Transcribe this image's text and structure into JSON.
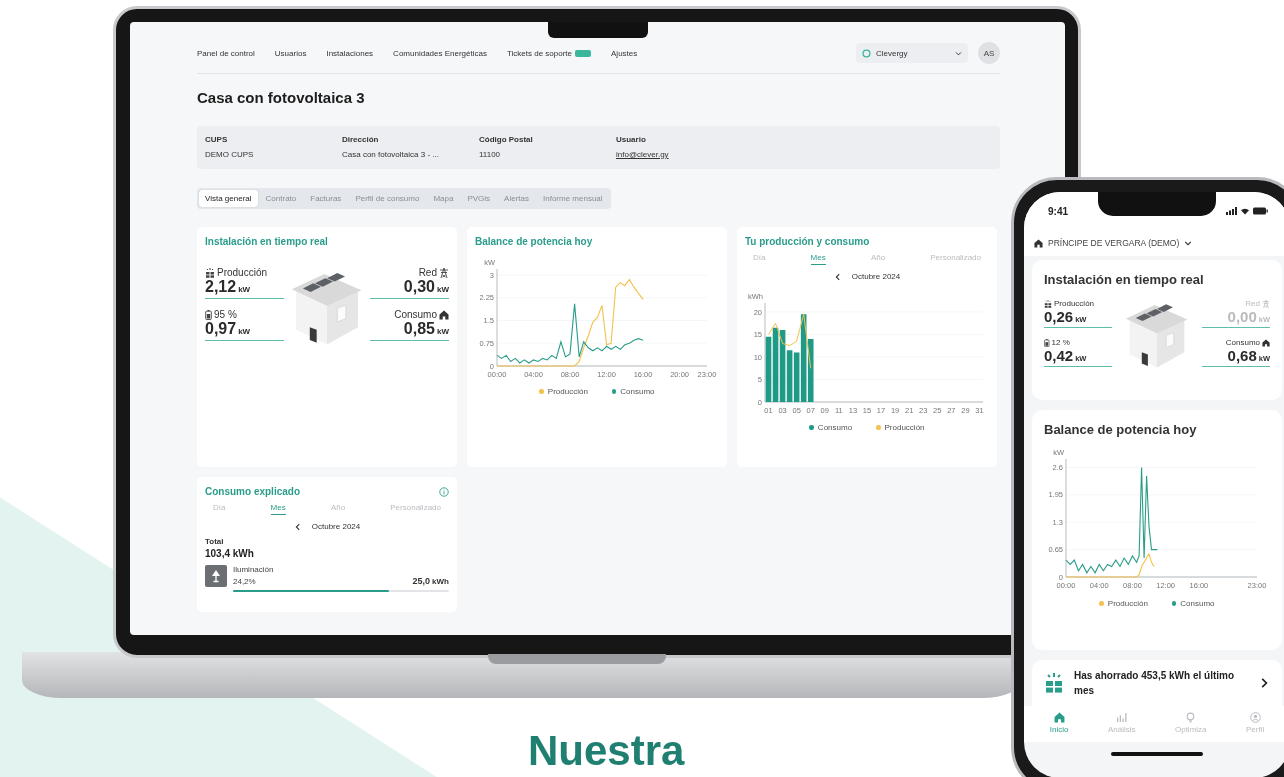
{
  "laptop": {
    "nav": {
      "items": [
        {
          "label": "Panel de control",
          "badge": false
        },
        {
          "label": "Usuarios",
          "badge": false
        },
        {
          "label": "Instalaciones",
          "badge": false
        },
        {
          "label": "Comunidades Energéticas",
          "badge": false
        },
        {
          "label": "Tickets de soporte",
          "badge": true
        },
        {
          "label": "Ajustes",
          "badge": false
        }
      ],
      "org": "Clevergy",
      "avatar": "AS"
    },
    "title": "Casa con fotovoltaica 3",
    "info": [
      {
        "label": "CUPS",
        "value": "DEMO CUPS",
        "kind": "text"
      },
      {
        "label": "Dirección",
        "value": "Casa con fotovoltaica 3 - ...",
        "kind": "text"
      },
      {
        "label": "Código Postal",
        "value": "11100",
        "kind": "text"
      },
      {
        "label": "Usuario",
        "value": "info@clever.gy",
        "kind": "link"
      }
    ],
    "tabs": [
      {
        "label": "Vista general",
        "selected": true
      },
      {
        "label": "Contrato",
        "selected": false
      },
      {
        "label": "Facturas",
        "selected": false
      },
      {
        "label": "Perfil de consumo",
        "selected": false
      },
      {
        "label": "Mapa",
        "selected": false
      },
      {
        "label": "PVGis",
        "selected": false
      },
      {
        "label": "Alertas",
        "selected": false
      },
      {
        "label": "Informe mensual",
        "selected": false
      }
    ],
    "realtime": {
      "title": "Instalación en tiempo real",
      "production": {
        "label": "Producción",
        "value": "2,12",
        "unit": "kW",
        "inactive": false
      },
      "grid": {
        "label": "Red",
        "value": "0,30",
        "unit": "kW",
        "inactive": false
      },
      "battery": {
        "label": "95 %",
        "value": "0,97",
        "unit": "kW",
        "inactive": false
      },
      "consumption": {
        "label": "Consumo",
        "value": "0,85",
        "unit": "kW",
        "inactive": false
      }
    },
    "balance": {
      "title": "Balance de potencia hoy",
      "chart_data": {
        "type": "line",
        "ylabel": "kW",
        "grid": true,
        "x": [
          0,
          0.5,
          1,
          1.5,
          2,
          2.5,
          3,
          3.5,
          4,
          4.5,
          5,
          5.5,
          6,
          6.5,
          7,
          7.5,
          8,
          8.5,
          9,
          9.5,
          10,
          10.5,
          11,
          11.5,
          12,
          12.5,
          13,
          13.5,
          14,
          14.5,
          15,
          15.5,
          16
        ],
        "xlim": [
          0,
          23
        ],
        "ylim": [
          0,
          3.2
        ],
        "xticks": [
          {
            "value": 0,
            "label": "00:00"
          },
          {
            "value": 4,
            "label": "04:00"
          },
          {
            "value": 8,
            "label": "08:00"
          },
          {
            "value": 12,
            "label": "12:00"
          },
          {
            "value": 16,
            "label": "16:00"
          },
          {
            "value": 20,
            "label": "20:00"
          },
          {
            "value": 23,
            "label": "23:00"
          }
        ],
        "yticks": [
          0,
          0.75,
          1.5,
          2.25,
          3
        ],
        "series": [
          {
            "name": "Producción",
            "color": "#f2c14e",
            "values": [
              0,
              0,
              0,
              0,
              0,
              0,
              0,
              0,
              0,
              0,
              0,
              0,
              0,
              0,
              0,
              0,
              0,
              0,
              0.15,
              0.6,
              1.0,
              1.45,
              1.6,
              2.0,
              0.7,
              0.75,
              2.6,
              2.75,
              2.65,
              2.85,
              2.6,
              2.4,
              2.2
            ]
          },
          {
            "name": "Consumo",
            "color": "#2a9d8a",
            "values": [
              0.35,
              0.25,
              0.35,
              0.15,
              0.25,
              0.1,
              0.2,
              0.1,
              0.2,
              0.15,
              0.25,
              0.2,
              0.35,
              0.25,
              0.8,
              0.3,
              0.4,
              2.05,
              0.3,
              0.8,
              0.6,
              0.5,
              0.6,
              0.5,
              0.65,
              0.55,
              0.65,
              0.55,
              0.7,
              0.75,
              0.85,
              0.9,
              0.85
            ]
          }
        ]
      }
    },
    "production_consumption": {
      "title": "Tu producción y consumo",
      "periods": [
        {
          "label": "Día",
          "selected": false
        },
        {
          "label": "Mes",
          "selected": true
        },
        {
          "label": "Año",
          "selected": false
        },
        {
          "label": "Personalizado",
          "selected": false
        }
      ],
      "month": "Octubre 2024",
      "chart_data": {
        "type": "bar",
        "ylabel": "kWh",
        "grid": true,
        "x": [
          1,
          2,
          3,
          4,
          5,
          6,
          7
        ],
        "xlim": [
          0.5,
          31.5
        ],
        "ylim": [
          0,
          22
        ],
        "yticks": [
          0,
          5,
          10,
          15,
          20
        ],
        "xticks": [
          {
            "value": 1,
            "label": "01"
          },
          {
            "value": 3,
            "label": "03"
          },
          {
            "value": 5,
            "label": "05"
          },
          {
            "value": 7,
            "label": "07"
          },
          {
            "value": 9,
            "label": "09"
          },
          {
            "value": 11,
            "label": "11"
          },
          {
            "value": 13,
            "label": "13"
          },
          {
            "value": 15,
            "label": "15"
          },
          {
            "value": 17,
            "label": "17"
          },
          {
            "value": 19,
            "label": "19"
          },
          {
            "value": 21,
            "label": "21"
          },
          {
            "value": 23,
            "label": "23"
          },
          {
            "value": 25,
            "label": "25"
          },
          {
            "value": 27,
            "label": "27"
          },
          {
            "value": 29,
            "label": "29"
          },
          {
            "value": 31,
            "label": "31"
          }
        ],
        "series": [
          {
            "name": "Consumo",
            "color": "#1f9a86",
            "type": "bar",
            "values": [
              14.5,
              16.5,
              16,
              11.5,
              11,
              19.5,
              14
            ]
          },
          {
            "name": "Producción",
            "color": "#f2c14e",
            "type": "line",
            "values": [
              15,
              17.5,
              13,
              12.5,
              13.5,
              19.5,
              7.5
            ]
          }
        ]
      }
    },
    "explained": {
      "title": "Consumo explicado",
      "periods": [
        {
          "label": "Día",
          "selected": false
        },
        {
          "label": "Mes",
          "selected": true
        },
        {
          "label": "Año",
          "selected": false
        },
        {
          "label": "Personalizado",
          "selected": false
        }
      ],
      "month": "Octubre 2024",
      "total_label": "Total",
      "total": "103,4 kWh",
      "items": [
        {
          "name": "Iluminación",
          "share": "24,2%",
          "value": "25,0",
          "unit": "kWh",
          "level": 0.72
        }
      ]
    }
  },
  "phone": {
    "time": "9:41",
    "location": "PRÍNCIPE DE VERGARA (DEMO)",
    "realtime": {
      "title": "Instalación en tiempo real",
      "production": {
        "label": "Producción",
        "value": "0,26",
        "unit": "kW",
        "inactive": false
      },
      "grid": {
        "label": "Red",
        "value": "0,00",
        "unit": "kW",
        "inactive": true
      },
      "battery": {
        "label": "12 %",
        "value": "0,42",
        "unit": "kW",
        "inactive": false
      },
      "consumption": {
        "label": "Consumo",
        "value": "0,68",
        "unit": "kW",
        "inactive": false
      }
    },
    "balance": {
      "title": "Balance de potencia hoy",
      "chart_data": {
        "type": "line",
        "ylabel": "kW",
        "grid": true,
        "x": [
          0,
          0.5,
          1,
          1.5,
          2,
          2.5,
          3,
          3.5,
          4,
          4.5,
          5,
          5.5,
          6,
          6.5,
          7,
          7.5,
          8,
          8.5,
          8.8,
          9.1,
          9.4,
          9.7,
          10,
          10.3,
          10.6,
          11
        ],
        "xlim": [
          0,
          23
        ],
        "ylim": [
          0,
          2.8
        ],
        "xticks": [
          {
            "value": 0,
            "label": "00:00"
          },
          {
            "value": 4,
            "label": "04:00"
          },
          {
            "value": 8,
            "label": "08:00"
          },
          {
            "value": 12,
            "label": "12:00"
          },
          {
            "value": 16,
            "label": "16:00"
          },
          {
            "value": 23,
            "label": "23:00"
          }
        ],
        "yticks": [
          0,
          0.65,
          1.3,
          1.95,
          2.6
        ],
        "series": [
          {
            "name": "Producción",
            "color": "#f2c14e",
            "values": [
              0,
              0,
              0,
              0,
              0,
              0,
              0,
              0,
              0,
              0,
              0,
              0,
              0,
              0,
              0,
              0,
              0,
              0,
              0.05,
              0.25,
              0.35,
              0.45,
              0.55,
              0.35,
              0.25,
              null
            ]
          },
          {
            "name": "Consumo",
            "color": "#2a9d8a",
            "values": [
              0.4,
              0.3,
              0.4,
              0.15,
              0.3,
              0.1,
              0.25,
              0.1,
              0.3,
              0.15,
              0.3,
              0.25,
              0.4,
              0.25,
              0.45,
              0.3,
              0.5,
              0.35,
              0.5,
              2.6,
              0.45,
              2.4,
              1.2,
              0.65,
              0.65,
              0.65
            ]
          }
        ]
      }
    },
    "savings": "Has ahorrado 453,5 kWh el último mes",
    "tabbar": [
      {
        "label": "Inicio",
        "kind": "home",
        "selected": true
      },
      {
        "label": "Análisis",
        "kind": "chart",
        "selected": false
      },
      {
        "label": "Optimiza",
        "kind": "bulb",
        "selected": false
      },
      {
        "label": "Perfil",
        "kind": "user",
        "selected": false
      }
    ]
  },
  "headline": "Nuestra"
}
